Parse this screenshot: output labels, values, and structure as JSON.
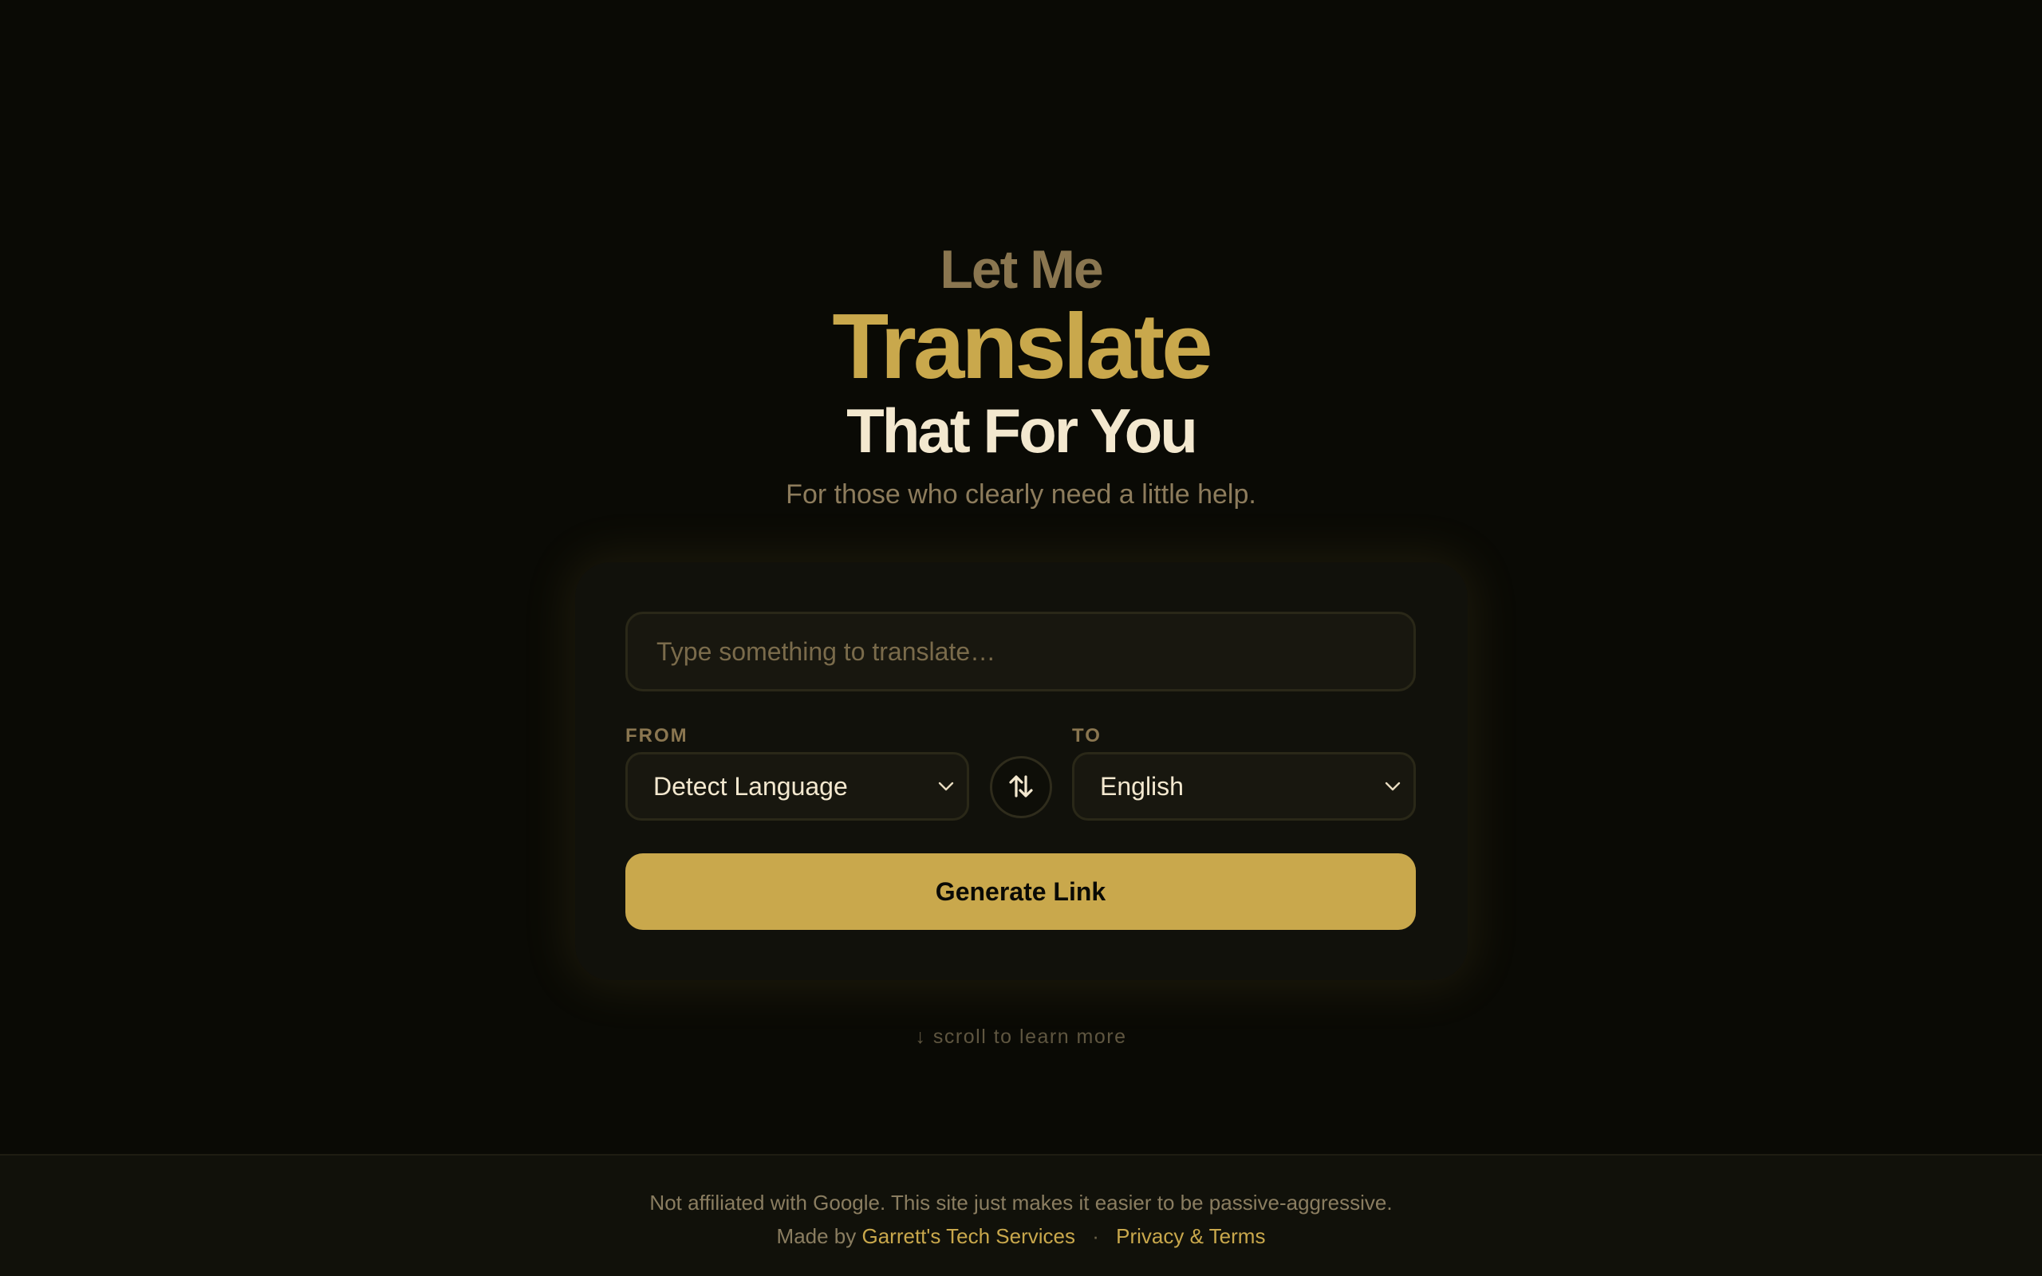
{
  "hero": {
    "kicker": "Let Me",
    "headline": "Translate",
    "subhead": "That For You",
    "tagline": "For those who clearly need a little help."
  },
  "form": {
    "input_placeholder": "Type something to translate…",
    "input_value": "",
    "from_label": "FROM",
    "from_value": "Detect Language",
    "to_label": "TO",
    "to_value": "English",
    "generate_label": "Generate Link"
  },
  "scroll_hint": "↓ scroll to learn more",
  "footer": {
    "disclaimer": "Not affiliated with Google. This site just makes it easier to be passive-aggressive.",
    "made_by_prefix": "Made by",
    "made_by_link": "Garrett's Tech Services",
    "separator": "·",
    "privacy_link": "Privacy & Terms"
  },
  "colors": {
    "accent": "#c9a84c",
    "background": "#0a0a05",
    "card": "#11110b",
    "text_light": "#f3e8cf",
    "text_muted": "#8a7650"
  },
  "icons": {
    "swap": "swap-vertical-arrows-icon",
    "select_chevron": "chevron-down-icon"
  }
}
